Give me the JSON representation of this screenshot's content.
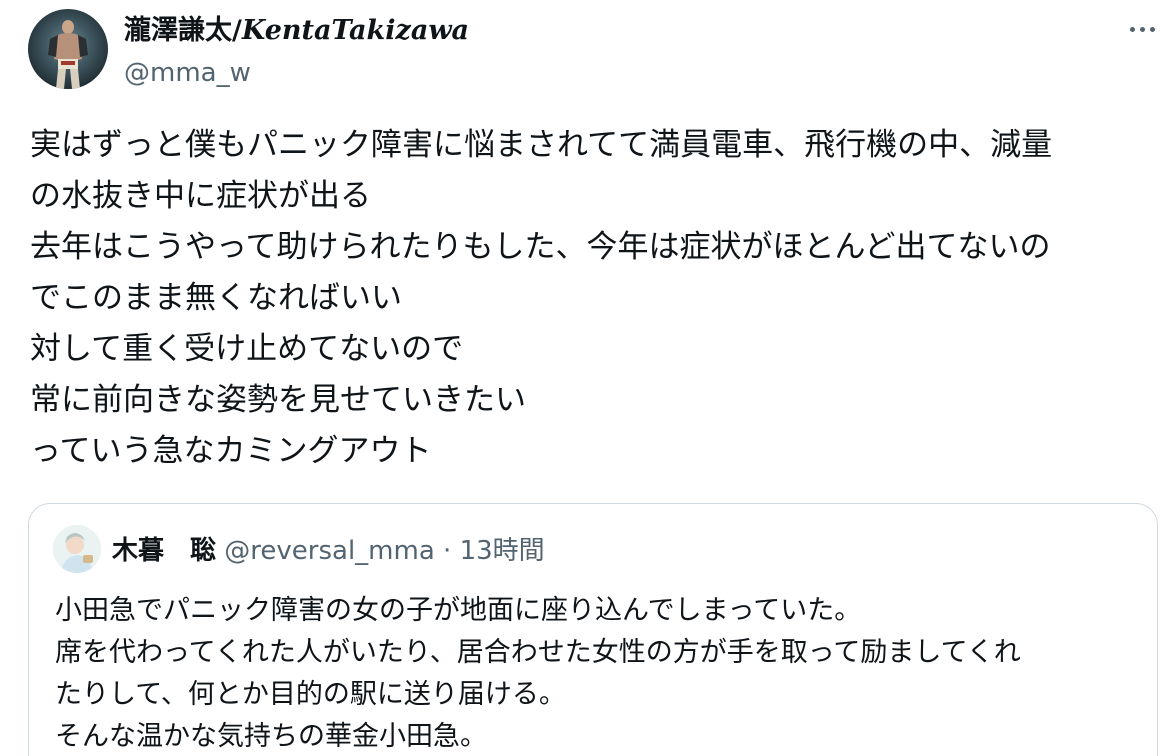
{
  "author": {
    "name_jp": "瀧澤謙太/",
    "name_latin": "KentaTakizawa",
    "handle": "@mma_w"
  },
  "more_menu": {
    "icon": "more-horizontal-icon"
  },
  "tweet_body": [
    "実はずっと僕もパニック障害に悩まされてて満員電車、飛行機の中、減量",
    "の水抜き中に症状が出る",
    "去年はこうやって助けられたりもした、今年は症状がほとんど出てないの",
    "でこのまま無くなればいい",
    "対して重く受け止めてないので",
    "常に前向きな姿勢を見せていきたい",
    "っていう急なカミングアウト"
  ],
  "quoted_tweet": {
    "name": "木暮　聡",
    "handle": "@reversal_mma",
    "separator": "·",
    "time": "13時間",
    "body": [
      "小田急でパニック障害の女の子が地面に座り込んでしまっていた。",
      "席を代わってくれた人がいたり、居合わせた女性の方が手を取って励ましてくれ",
      "たりして、何とか目的の駅に送り届ける。",
      "そんな温かな気持ちの華金小田急。"
    ]
  },
  "colors": {
    "text_primary": "#0f1419",
    "text_secondary": "#536471",
    "border": "#cfd9de"
  }
}
